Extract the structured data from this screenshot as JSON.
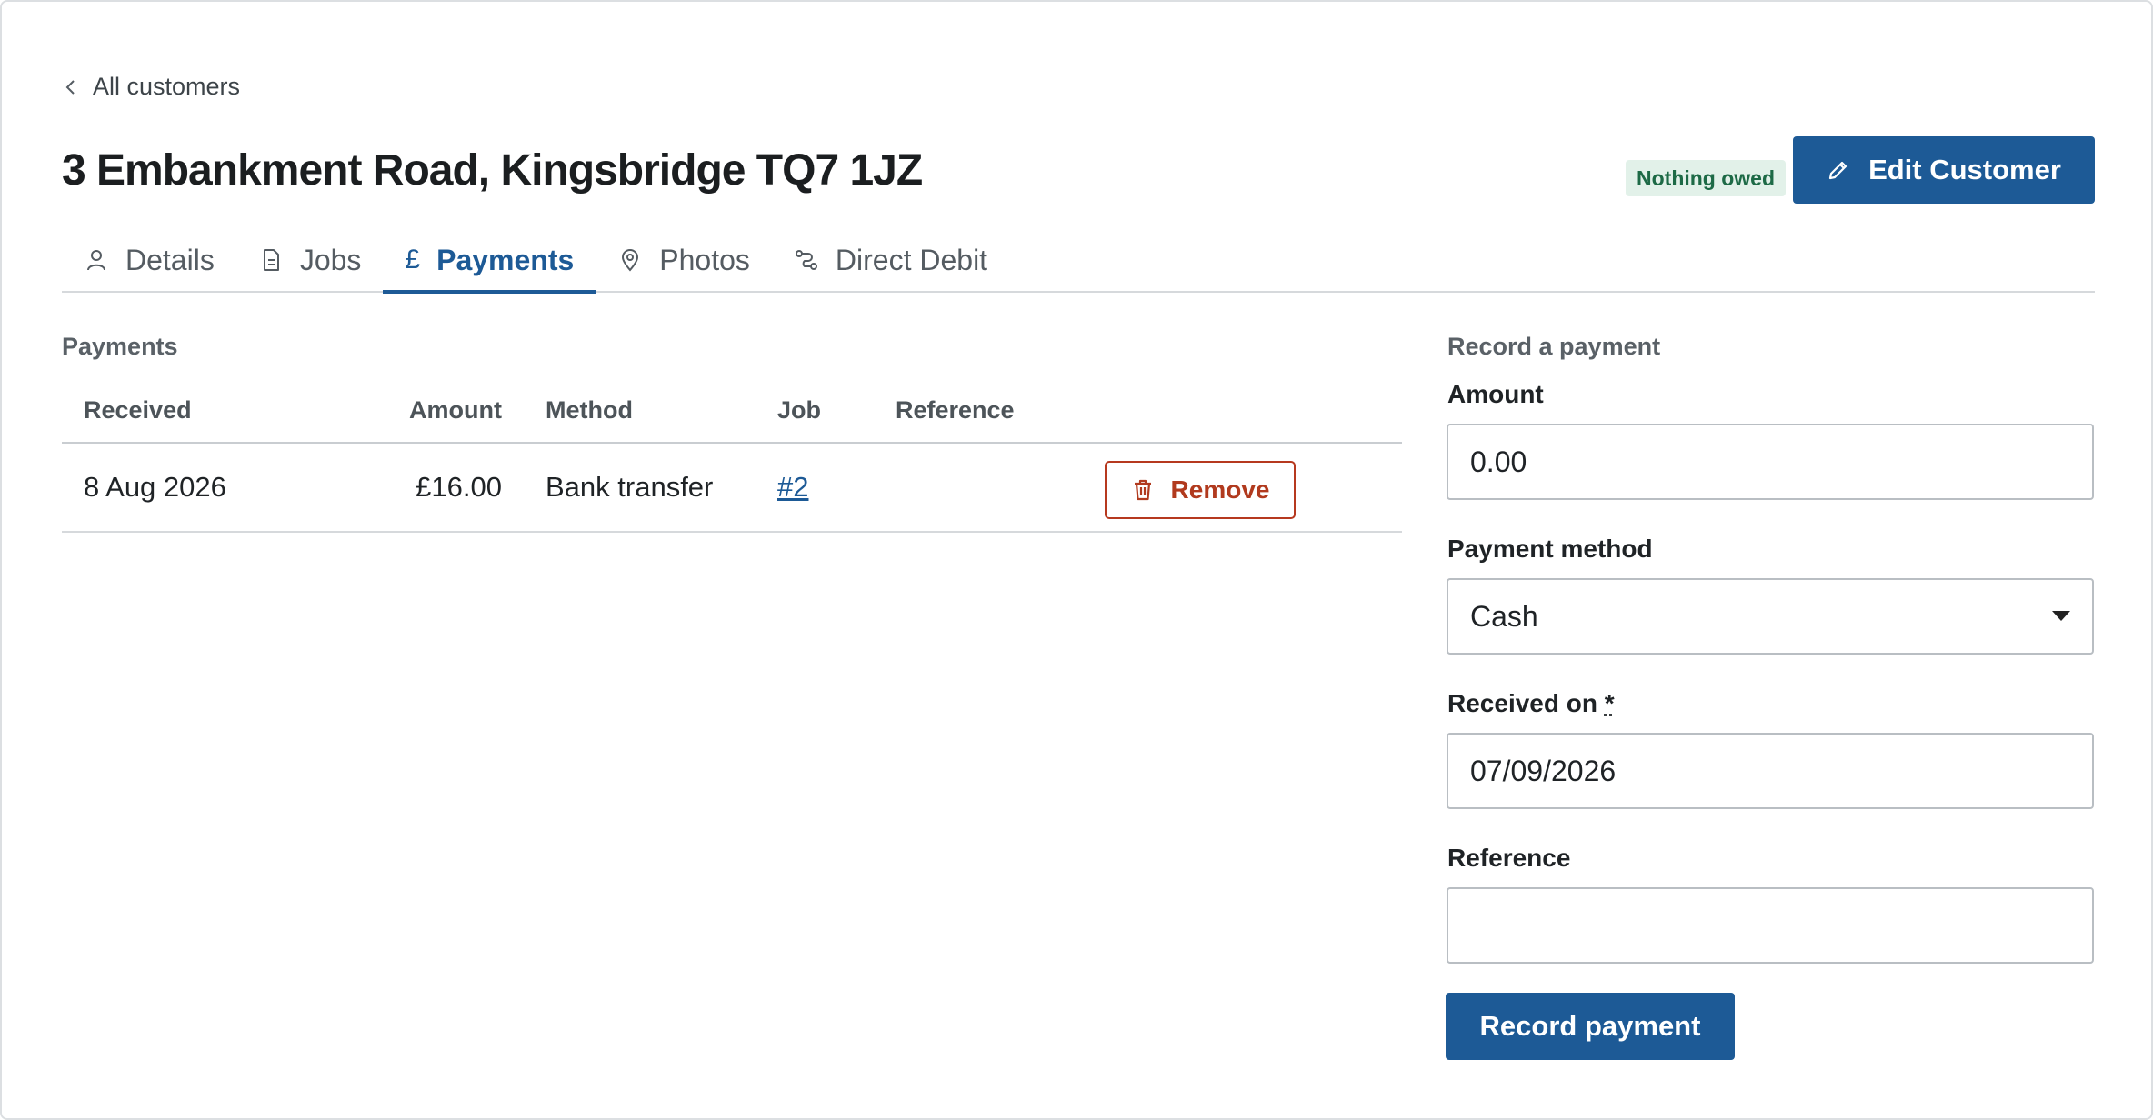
{
  "breadcrumb": {
    "back_label": "All customers"
  },
  "header": {
    "title": "3 Embankment Road, Kingsbridge TQ7 1JZ",
    "badge": "Nothing owed",
    "edit_button": "Edit Customer"
  },
  "tabs": [
    {
      "label": "Details",
      "icon": "person-icon",
      "active": false
    },
    {
      "label": "Jobs",
      "icon": "document-icon",
      "active": false
    },
    {
      "label": "Payments",
      "icon": "pound-icon",
      "glyph": "£",
      "active": true
    },
    {
      "label": "Photos",
      "icon": "map-pin-icon",
      "active": false
    },
    {
      "label": "Direct Debit",
      "icon": "route-icon",
      "active": false
    }
  ],
  "payments": {
    "section_title": "Payments",
    "columns": [
      "Received",
      "Amount",
      "Method",
      "Job",
      "Reference"
    ],
    "rows": [
      {
        "received": "8 Aug 2026",
        "amount": "£16.00",
        "method": "Bank transfer",
        "job": "#2",
        "reference": "",
        "remove_label": "Remove"
      }
    ]
  },
  "record_form": {
    "title": "Record a payment",
    "amount_label": "Amount",
    "amount_value": "0.00",
    "method_label": "Payment method",
    "method_value": "Cash",
    "received_label": "Received on",
    "required_marker": "*",
    "received_value": "07/09/2026",
    "reference_label": "Reference",
    "reference_value": "",
    "submit_label": "Record payment"
  },
  "colors": {
    "primary": "#1d5a96",
    "danger": "#b13a1e",
    "badge_bg": "#e2f1e9",
    "badge_text": "#1d6a46"
  }
}
